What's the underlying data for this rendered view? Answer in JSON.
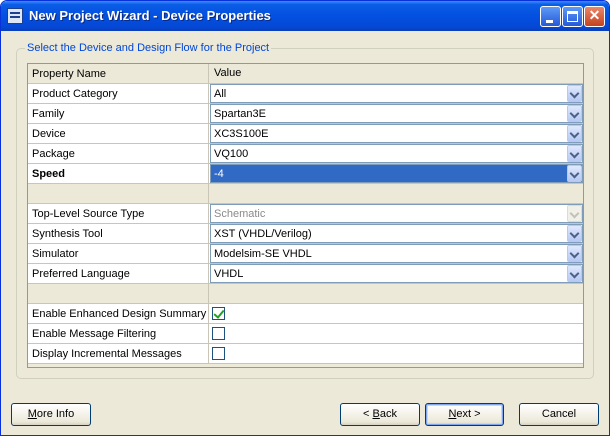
{
  "window": {
    "title": "New Project Wizard - Device Properties"
  },
  "group": {
    "label": "Select the Device and Design Flow for the Project"
  },
  "grid": {
    "header": {
      "name": "Property Name",
      "value": "Value"
    },
    "rows": [
      {
        "name": "Product Category",
        "value": "All"
      },
      {
        "name": "Family",
        "value": "Spartan3E"
      },
      {
        "name": "Device",
        "value": "XC3S100E"
      },
      {
        "name": "Package",
        "value": "VQ100"
      },
      {
        "name": "Speed",
        "value": "-4"
      },
      {
        "name": "Top-Level Source Type",
        "value": "Schematic"
      },
      {
        "name": "Synthesis Tool",
        "value": "XST (VHDL/Verilog)"
      },
      {
        "name": "Simulator",
        "value": "Modelsim-SE VHDL"
      },
      {
        "name": "Preferred Language",
        "value": "VHDL"
      },
      {
        "name": "Enable Enhanced Design Summary",
        "checked": true
      },
      {
        "name": "Enable Message Filtering",
        "checked": false
      },
      {
        "name": "Display Incremental Messages",
        "checked": false
      }
    ]
  },
  "buttons": {
    "more_info": {
      "mnemonic": "M",
      "rest": "ore Info"
    },
    "back": {
      "prefix": "< ",
      "mnemonic": "B",
      "rest": "ack"
    },
    "next": {
      "mnemonic": "N",
      "rest": "ext >"
    },
    "cancel": "Cancel"
  },
  "colors": {
    "title_bar": "#0450e0",
    "selection": "#316ac5",
    "group_label": "#0046d5",
    "dialog_bg": "#ece9d8"
  }
}
